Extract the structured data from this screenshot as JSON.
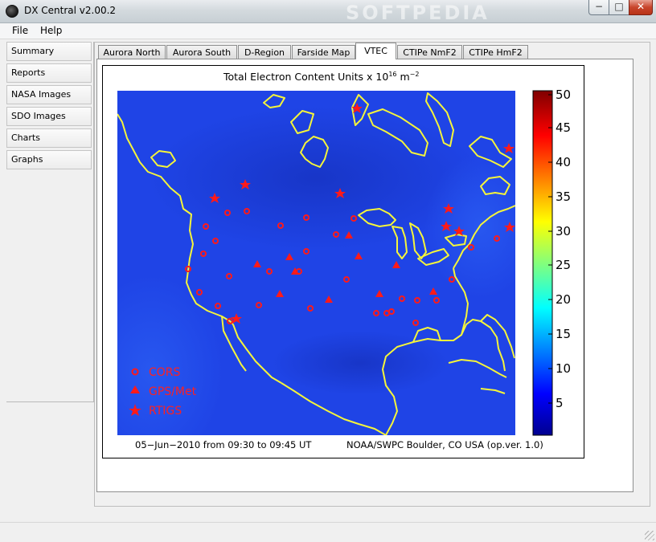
{
  "window": {
    "title": "DX Central  v2.00.2",
    "watermark": "SOFTPEDIA",
    "min_label": "−",
    "max_label": "□",
    "close_label": "✕"
  },
  "menu": {
    "file": "File",
    "help": "Help"
  },
  "sidebar": {
    "items": [
      {
        "label": "Summary"
      },
      {
        "label": "Reports"
      },
      {
        "label": "NASA Images"
      },
      {
        "label": "SDO Images"
      },
      {
        "label": "Charts"
      },
      {
        "label": "Graphs"
      }
    ]
  },
  "tabs": [
    {
      "label": "Aurora North"
    },
    {
      "label": "Aurora South"
    },
    {
      "label": "D-Region"
    },
    {
      "label": "Farside Map"
    },
    {
      "label": "VTEC",
      "active": true
    },
    {
      "label": "CTIPe NmF2"
    },
    {
      "label": "CTIPe HmF2"
    }
  ],
  "plot": {
    "title": "Total Electron Content Units x 10",
    "title_exp": "16",
    "title_unit": " m",
    "title_unit_exp": "−2",
    "footer_left": "05−Jun−2010 from 09:30 to 09:45 UT",
    "footer_right": "NOAA/SWPC Boulder, CO USA (op.ver. 1.0)",
    "colorbar_ticks": [
      "5",
      "10",
      "15",
      "20",
      "25",
      "30",
      "35",
      "40",
      "45",
      "50"
    ],
    "legend": [
      {
        "symbol": "circle",
        "label": "CORS"
      },
      {
        "symbol": "triangle",
        "label": "GPS/Met"
      },
      {
        "symbol": "star",
        "label": "RTIGS"
      }
    ],
    "colors": {
      "map_fill": "#1f44e6",
      "map_dark": "#1733c8",
      "coast": "#f5f53a",
      "marker": "#ff1a1a"
    }
  }
}
